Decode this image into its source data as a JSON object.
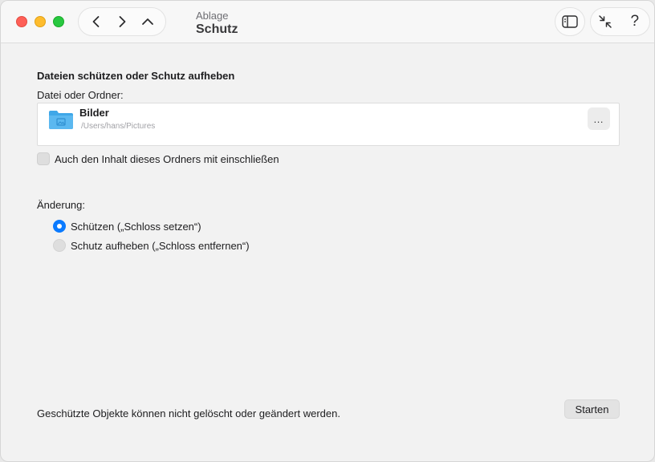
{
  "window": {
    "traffic_lights": [
      "close",
      "minimize",
      "maximize"
    ]
  },
  "toolbar": {
    "back_icon": "chevron-left-icon",
    "forward_icon": "chevron-right-icon",
    "up_icon": "chevron-up-icon",
    "breadcrumb_parent": "Ablage",
    "title": "Schutz",
    "sidebar_icon": "sidebar-icon",
    "collapse_icon": "collapse-arrows-icon",
    "help_label": "?"
  },
  "main": {
    "section_title": "Dateien schützen oder Schutz aufheben",
    "file_field_label": "Datei oder Ordner:",
    "file": {
      "icon": "folder-icon",
      "name": "Bilder",
      "path": "/Users/hans/Pictures",
      "more_label": "…"
    },
    "include_contents": {
      "label": "Auch den Inhalt dieses Ordners mit einschließen",
      "checked": false
    },
    "change_label": "Änderung:",
    "options": [
      {
        "label": "Schützen („Schloss setzen“)",
        "selected": true
      },
      {
        "label": "Schutz aufheben („Schloss entfernen“)",
        "selected": false
      }
    ],
    "footer_note": "Geschützte Objekte können nicht gelöscht oder geändert werden.",
    "start_button": "Starten"
  },
  "colors": {
    "accent": "#0a7aff",
    "folder": "#3fa7e8"
  }
}
